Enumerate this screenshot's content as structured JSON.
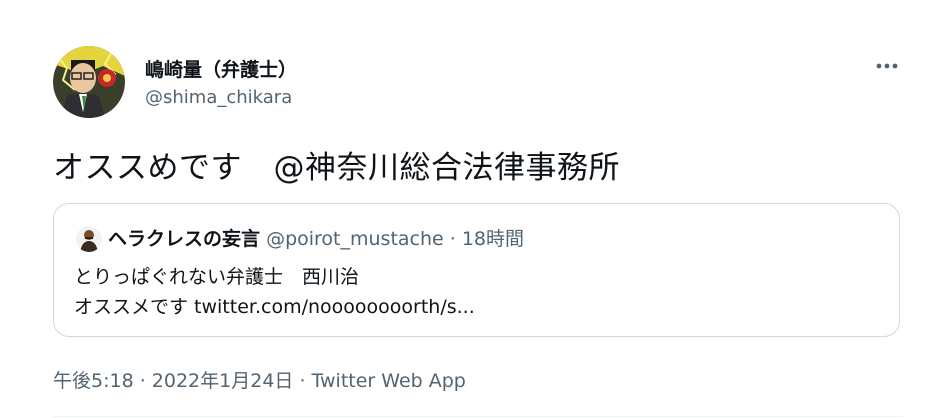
{
  "tweet": {
    "author": {
      "display_name": "嶋崎量（弁護士）",
      "handle": "@shima_chikara"
    },
    "text": "オススめです　@神奈川総合法律事務所",
    "more_label": "•••",
    "quote": {
      "author_name": "ヘラクレスの妄言",
      "author_handle": "@poirot_mustache",
      "separator": " · ",
      "time_ago": "18時間",
      "line1": "とりっぱぐれない弁護士　西川治",
      "line2": "オススメです twitter.com/noooooooorth/s..."
    },
    "meta": {
      "time": "午後5:18",
      "separator1": " · ",
      "date": "2022年1月24日",
      "separator2": " · ",
      "source": "Twitter Web App"
    }
  },
  "colors": {
    "text_primary": "#0f1419",
    "text_secondary": "#536471",
    "border": "#cfd9de"
  }
}
